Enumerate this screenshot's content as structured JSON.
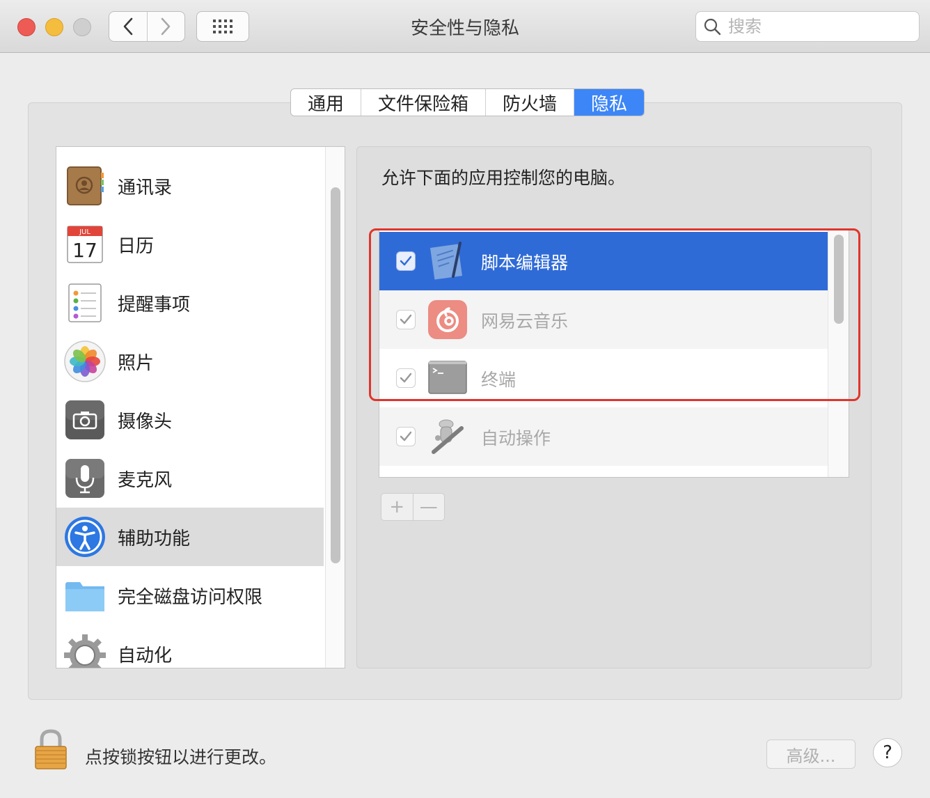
{
  "window": {
    "title": "安全性与隐私",
    "search_placeholder": "搜索"
  },
  "tabs": [
    {
      "label": "通用"
    },
    {
      "label": "文件保险箱"
    },
    {
      "label": "防火墙"
    },
    {
      "label": "隐私",
      "active": true
    }
  ],
  "sidebar": {
    "items": [
      {
        "label": "通讯录",
        "icon": "contacts-icon"
      },
      {
        "label": "日历",
        "icon": "calendar-icon",
        "calendar_month": "JUL",
        "calendar_day": "17"
      },
      {
        "label": "提醒事项",
        "icon": "reminders-icon"
      },
      {
        "label": "照片",
        "icon": "photos-icon"
      },
      {
        "label": "摄像头",
        "icon": "camera-icon"
      },
      {
        "label": "麦克风",
        "icon": "microphone-icon"
      },
      {
        "label": "辅助功能",
        "icon": "accessibility-icon",
        "selected": true
      },
      {
        "label": "完全磁盘访问权限",
        "icon": "folder-icon"
      },
      {
        "label": "自动化",
        "icon": "gear-icon"
      }
    ]
  },
  "panel": {
    "description": "允许下面的应用控制您的电脑。",
    "apps": [
      {
        "label": "脚本编辑器",
        "icon": "script-editor-icon",
        "checked": true,
        "selected": true
      },
      {
        "label": "网易云音乐",
        "icon": "netease-music-icon",
        "checked": true
      },
      {
        "label": "终端",
        "icon": "terminal-icon",
        "checked": true
      },
      {
        "label": "自动操作",
        "icon": "automator-icon",
        "checked": true
      }
    ],
    "add_label": "+",
    "remove_label": "—"
  },
  "footer": {
    "lock_text": "点按锁按钮以进行更改。",
    "advanced_label": "高级...",
    "help_label": "?"
  },
  "colors": {
    "tab_active": "#3d86f7",
    "row_selected": "#2f6bd7",
    "highlight": "#e0342b"
  }
}
